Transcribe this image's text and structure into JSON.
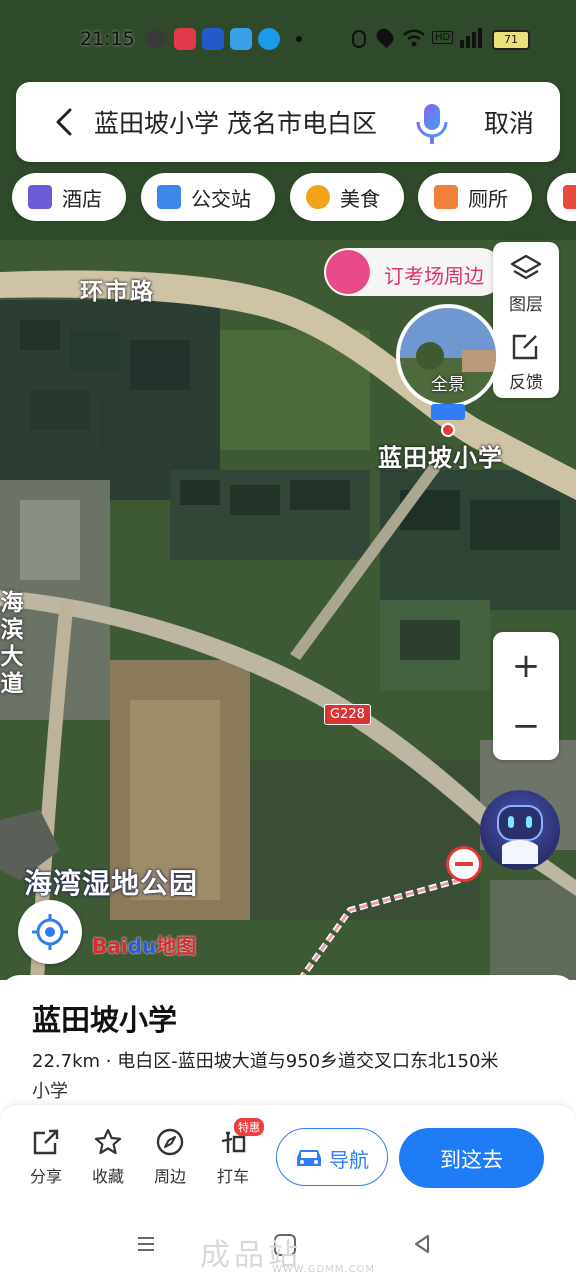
{
  "status": {
    "time": "21:15",
    "hd": "HD",
    "battery": "71"
  },
  "search": {
    "query": "蓝田坡小学 茂名市电白区",
    "cancel_label": "取消"
  },
  "chips": [
    {
      "label": "酒店",
      "color": "#6a5bd6"
    },
    {
      "label": "公交站",
      "color": "#3b88e8"
    },
    {
      "label": "美食",
      "color": "#f2a21b"
    },
    {
      "label": "厕所",
      "color": "#f0803a"
    }
  ],
  "map": {
    "road_huanshi": "环市路",
    "road_haibin": "海滨大道",
    "order_banner": "订考场周边",
    "layers_label": "图层",
    "feedback_label": "反馈",
    "panorama_label": "全景",
    "poi_label": "蓝田坡小学",
    "road_tag": "G228",
    "zoom_in": "+",
    "zoom_out": "−",
    "park_label": "海湾湿地公园",
    "brand_bai": "Bai",
    "brand_du": "du",
    "brand_map": "地图"
  },
  "card": {
    "title": "蓝田坡小学",
    "address": "22.7km · 电白区-蓝田坡大道与950乡道交叉口东北150米",
    "category": "小学"
  },
  "actions": {
    "share": "分享",
    "favorite": "收藏",
    "nearby": "周边",
    "taxi": "打车",
    "taxi_badge": "特惠",
    "navigate": "导航",
    "go_here": "到这去"
  },
  "watermark": {
    "text": "成品站",
    "url": "WWW.GDMM.COM"
  }
}
